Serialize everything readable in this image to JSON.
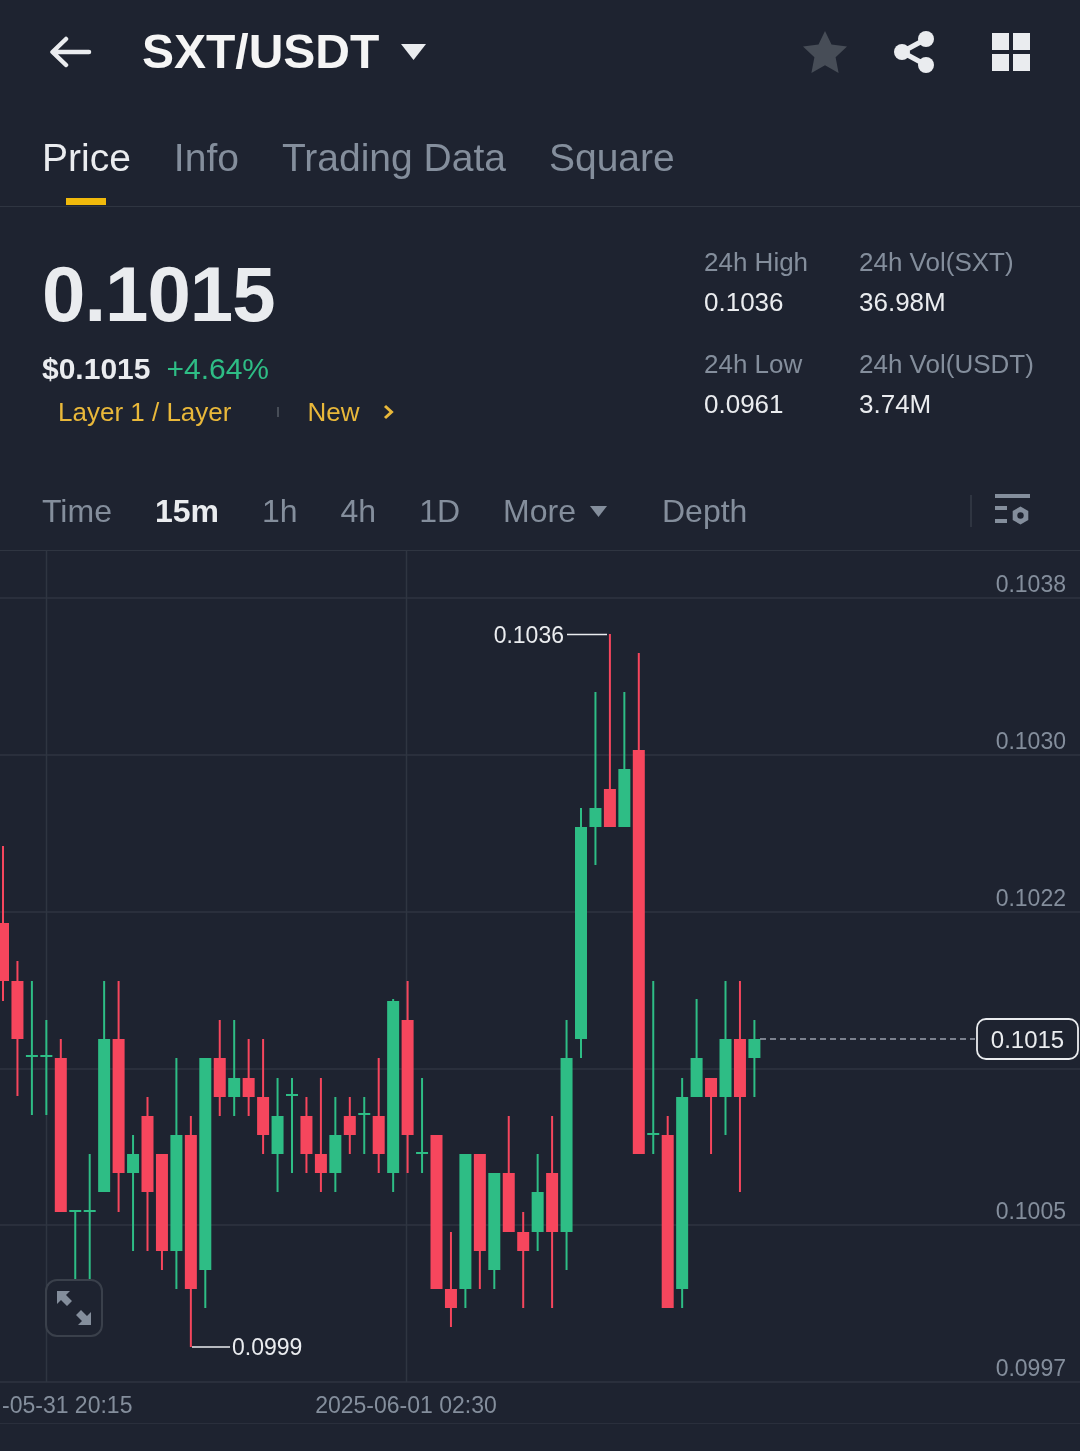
{
  "header": {
    "title": "SXT/USDT",
    "favorited": false
  },
  "tabs": [
    {
      "label": "Price",
      "selected": true
    },
    {
      "label": "Info",
      "selected": false
    },
    {
      "label": "Trading Data",
      "selected": false
    },
    {
      "label": "Square",
      "selected": false
    }
  ],
  "ticker": {
    "last_price": "0.1015",
    "usd_price": "$0.1015",
    "change": "+4.64%",
    "tags": [
      "Layer 1 / Layer",
      "New"
    ]
  },
  "stats": [
    {
      "label": "24h High",
      "value": "0.1036"
    },
    {
      "label": "24h Vol(SXT)",
      "value": "36.98M"
    },
    {
      "label": "24h Low",
      "value": "0.0961"
    },
    {
      "label": "24h Vol(USDT)",
      "value": "3.74M"
    }
  ],
  "chart_tabs": [
    {
      "label": "Time",
      "kind": "plain",
      "selected": false
    },
    {
      "label": "15m",
      "kind": "plain",
      "selected": true
    },
    {
      "label": "1h",
      "kind": "plain",
      "selected": false
    },
    {
      "label": "4h",
      "kind": "plain",
      "selected": false
    },
    {
      "label": "1D",
      "kind": "plain",
      "selected": false
    },
    {
      "label": "More",
      "kind": "dropdown",
      "selected": false
    },
    {
      "label": "Depth",
      "kind": "plain",
      "selected": false
    }
  ],
  "chart": {
    "price_axis": [
      "0.1038",
      "0.1030",
      "0.1022",
      "0.1005",
      "0.0997"
    ],
    "high_marker": "0.1036",
    "low_marker": "0.0999",
    "last_price": "0.1015",
    "time_axis": [
      "-05-31 20:15",
      "2025-06-01 02:30"
    ]
  }
}
